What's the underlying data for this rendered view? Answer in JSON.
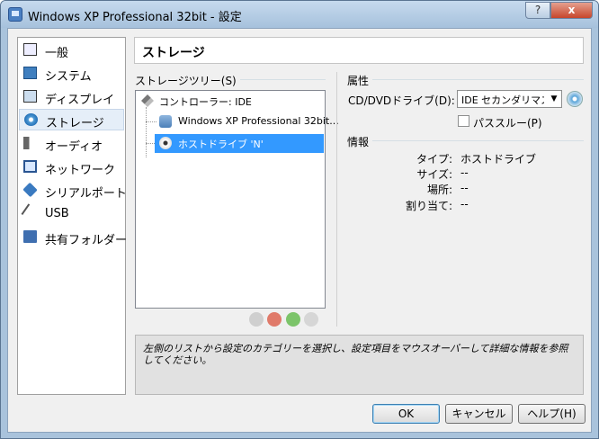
{
  "window": {
    "title": "Windows XP Professional 32bit - 設定",
    "help_glyph": "?",
    "close_glyph": "x"
  },
  "sidebar": {
    "items": [
      {
        "label": "一般",
        "icon": "monitor-icon"
      },
      {
        "label": "システム",
        "icon": "chip-icon"
      },
      {
        "label": "ディスプレイ",
        "icon": "display-icon"
      },
      {
        "label": "ストレージ",
        "icon": "disk-icon",
        "selected": true
      },
      {
        "label": "オーディオ",
        "icon": "speaker-icon"
      },
      {
        "label": "ネットワーク",
        "icon": "network-icon"
      },
      {
        "label": "シリアルポート",
        "icon": "serial-port-icon"
      },
      {
        "label": "USB",
        "icon": "usb-icon"
      },
      {
        "label": "共有フォルダー",
        "icon": "folder-icon"
      }
    ]
  },
  "page": {
    "title": "ストレージ"
  },
  "storage_tree": {
    "label": "ストレージツリー(S)",
    "controller": "コントローラー: IDE",
    "items": [
      {
        "label": "Windows XP Professional 32bit...",
        "icon": "hard-disk-icon"
      },
      {
        "label": "ホストドライブ 'N'",
        "icon": "cd-icon",
        "selected": true
      }
    ]
  },
  "attributes": {
    "label": "属性",
    "drive_label": "CD/DVDドライブ(D):",
    "drive_value": "IDE セカンダリマスター",
    "arrow_glyph": "▼",
    "passthrough_label": "パススルー(P)"
  },
  "info": {
    "label": "情報",
    "rows": [
      {
        "key": "タイプ:",
        "value": "ホストドライブ"
      },
      {
        "key": "サイズ:",
        "value": "--"
      },
      {
        "key": "場所:",
        "value": "--"
      },
      {
        "key": "割り当て:",
        "value": "--"
      }
    ]
  },
  "hint": "左側のリストから設定のカテゴリーを選択し、設定項目をマウスオーバーして詳細な情報を参照してください。",
  "buttons": {
    "ok": "OK",
    "cancel": "キャンセル",
    "help": "ヘルプ(H)"
  },
  "colors": {
    "selection": "#3399ff",
    "titlebar": "#a6c1dc"
  }
}
